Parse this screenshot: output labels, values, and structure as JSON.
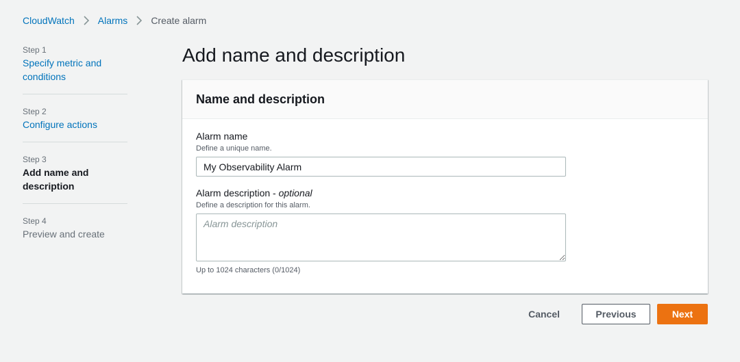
{
  "breadcrumb": {
    "items": [
      {
        "label": "CloudWatch"
      },
      {
        "label": "Alarms"
      },
      {
        "label": "Create alarm"
      }
    ]
  },
  "steps": [
    {
      "number": "Step 1",
      "title": "Specify metric and conditions",
      "state": "link"
    },
    {
      "number": "Step 2",
      "title": "Configure actions",
      "state": "link"
    },
    {
      "number": "Step 3",
      "title": "Add name and description",
      "state": "active"
    },
    {
      "number": "Step 4",
      "title": "Preview and create",
      "state": "disabled"
    }
  ],
  "page_title": "Add name and description",
  "container": {
    "title": "Name and description",
    "alarm_name": {
      "label": "Alarm name",
      "description": "Define a unique name.",
      "value": "My Observability Alarm"
    },
    "alarm_description": {
      "label": "Alarm description",
      "optional": "optional",
      "description": "Define a description for this alarm.",
      "placeholder": "Alarm description",
      "value": "",
      "constraint": "Up to 1024 characters (0/1024)"
    }
  },
  "actions": {
    "cancel": "Cancel",
    "previous": "Previous",
    "next": "Next"
  },
  "colors": {
    "link": "#0073bb",
    "primary": "#ec7211",
    "background": "#f2f3f3"
  }
}
